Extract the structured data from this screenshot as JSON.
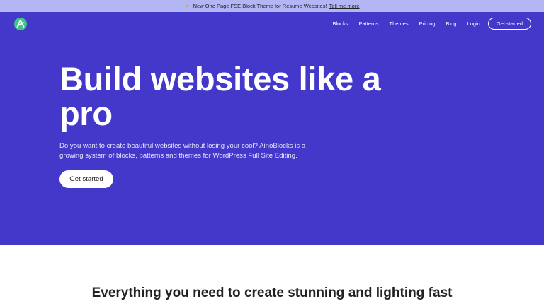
{
  "announcement": {
    "icon": "star-icon",
    "text": "New One Page FSE Block Theme for Resume Websites!",
    "link_text": "Tell me more"
  },
  "header": {
    "logo_icon": "ainoblocks-logo-icon",
    "nav": [
      "Blocks",
      "Patterns",
      "Themes",
      "Pricing",
      "Blog",
      "Login"
    ],
    "cta_label": "Get started"
  },
  "hero": {
    "title": "Build websites like a pro",
    "subtitle": "Do you want to create beautiful websites without losing your cool? AinoBlocks is a growing system of blocks, patterns and themes for WordPress Full Site Editing.",
    "button_label": "Get started",
    "background": "#4338ca"
  },
  "features": {
    "heading": "Everything you need to create stunning and lighting fast"
  },
  "colors": {
    "announcement_bg": "#b3b6f5",
    "logo_bg": "#3fc48a",
    "hero_bg": "#4338ca"
  }
}
